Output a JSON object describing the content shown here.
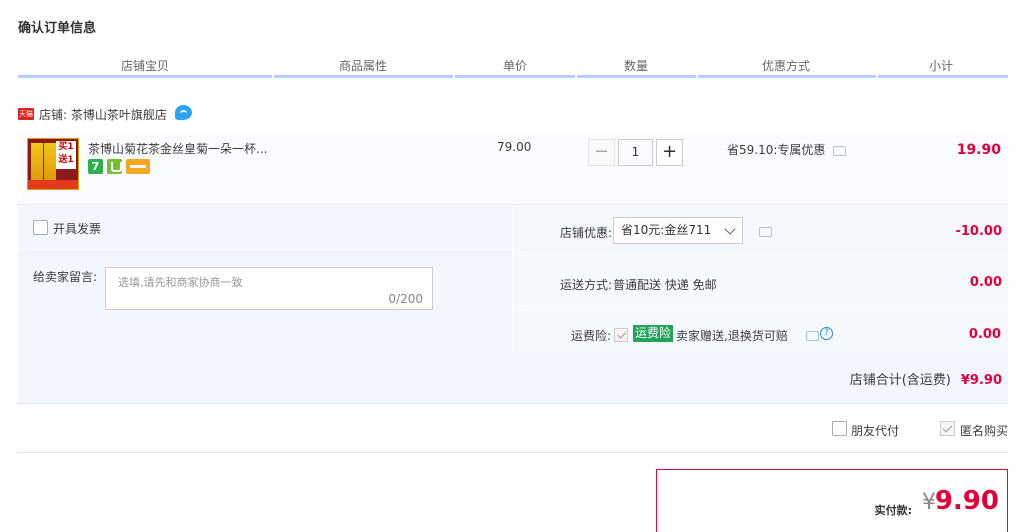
{
  "page_title": "确认订单信息",
  "columns": [
    "店铺宝贝",
    "商品属性",
    "单价",
    "数量",
    "优惠方式",
    "小计"
  ],
  "shop": {
    "badge": "天猫",
    "label": "店铺: 茶博山茶叶旗舰店"
  },
  "item": {
    "thumb_text": "买1送1",
    "title": "茶博山菊花茶金丝皇菊一朵一杯...",
    "service_icons": [
      "7",
      "shield-icon",
      "card-icon"
    ],
    "unit_price": "79.00",
    "quantity": "1",
    "minus": "−",
    "plus": "+",
    "promo": "省59.10:专属优惠",
    "subtotal": "19.90"
  },
  "options": {
    "invoice_label": "开具发票",
    "memo_label": "给卖家留言:",
    "memo_placeholder": "选填,请先和商家协商一致",
    "memo_count": "0/200",
    "shop_discount_label": "店铺优惠:",
    "shop_discount_value": "省10元:金丝711",
    "shop_discount_amount": "-10.00",
    "shipping_label": "运送方式:",
    "shipping_value": "普通配送 快递 免邮",
    "shipping_amount": "0.00",
    "insurance_label": "运费险:",
    "insurance_tag": "运费险",
    "insurance_text": "卖家赠送,退换货可赔",
    "insurance_amount": "0.00",
    "shop_total_label": "店铺合计(含运费)",
    "shop_total_amount": "¥9.90"
  },
  "extras": {
    "friend_pay_label": "朋友代付",
    "anonymous_label": "匿名购买"
  },
  "payment": {
    "label": "实付款:",
    "currency": "¥",
    "amount": "9.90"
  },
  "colors": {
    "accent_red": "#e4003a",
    "header_line": "#b2d1ff",
    "panel_bg": "#f2f7ff"
  }
}
